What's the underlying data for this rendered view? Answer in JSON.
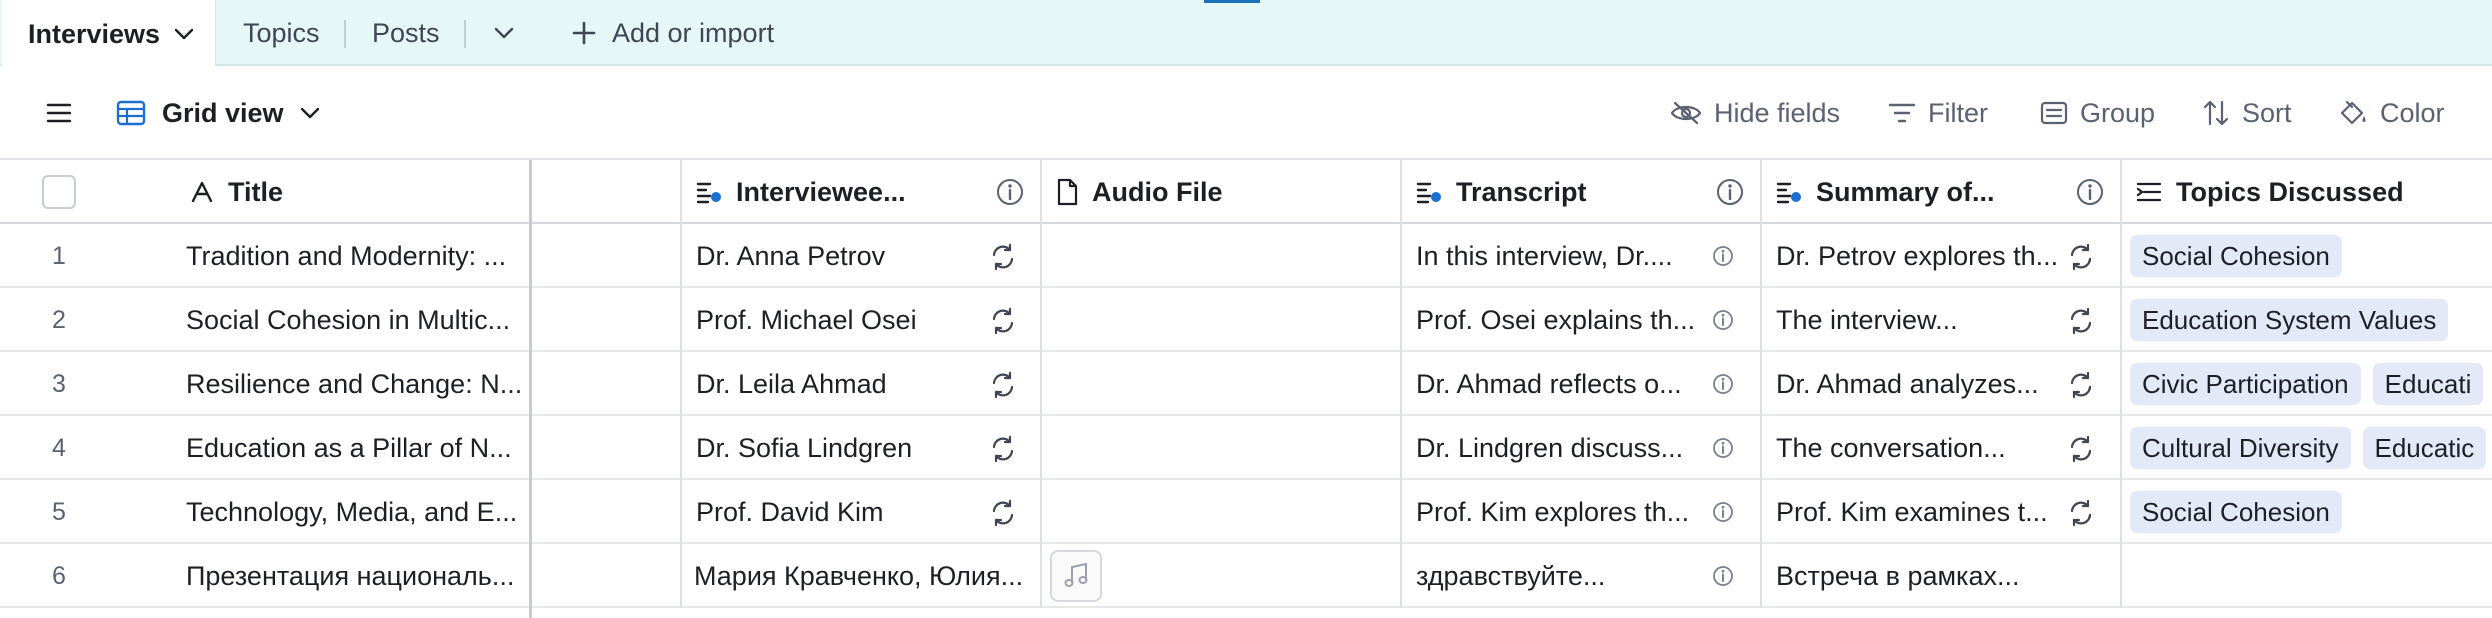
{
  "tabs": {
    "active": "Interviews",
    "others": [
      "Topics",
      "Posts"
    ],
    "add_import": "Add or import"
  },
  "viewbar": {
    "view_name": "Grid view",
    "hide_fields": "Hide fields",
    "filter": "Filter",
    "group": "Group",
    "sort": "Sort",
    "color": "Color"
  },
  "columns": {
    "title": "Title",
    "interviewee": "Interviewee...",
    "audio_file": "Audio File",
    "transcript": "Transcript",
    "summary": "Summary of...",
    "topics": "Topics Discussed"
  },
  "rows": [
    {
      "num": "1",
      "title": "Tradition and Modernity: ...",
      "interviewee": "Dr. Anna Petrov",
      "transcript": "In this interview, Dr....",
      "summary": "Dr. Petrov explores th...",
      "topics": [
        "Social Cohesion"
      ]
    },
    {
      "num": "2",
      "title": "Social Cohesion in Multic...",
      "interviewee": "Prof. Michael Osei",
      "transcript": "Prof. Osei explains th...",
      "summary": "The interview...",
      "topics": [
        "Education System Values"
      ]
    },
    {
      "num": "3",
      "title": "Resilience and Change: N...",
      "interviewee": "Dr. Leila Ahmad",
      "transcript": "Dr. Ahmad reflects o...",
      "summary": "Dr. Ahmad analyzes...",
      "topics": [
        "Civic Participation",
        "Educati"
      ]
    },
    {
      "num": "4",
      "title": "Education as a Pillar of N...",
      "interviewee": "Dr. Sofia Lindgren",
      "transcript": "Dr. Lindgren discuss...",
      "summary": "The conversation...",
      "topics": [
        "Cultural Diversity",
        "Educatic"
      ]
    },
    {
      "num": "5",
      "title": "Technology, Media, and E...",
      "interviewee": "Prof. David Kim",
      "transcript": "Prof. Kim explores th...",
      "summary": "Prof. Kim examines t...",
      "topics": [
        "Social Cohesion"
      ]
    },
    {
      "num": "6",
      "title": "Презентация националь...",
      "interviewee": "Мария Кравченко, Юлия...",
      "transcript": "здравствуйте...",
      "summary": "Встреча в рамках...",
      "topics": []
    }
  ]
}
